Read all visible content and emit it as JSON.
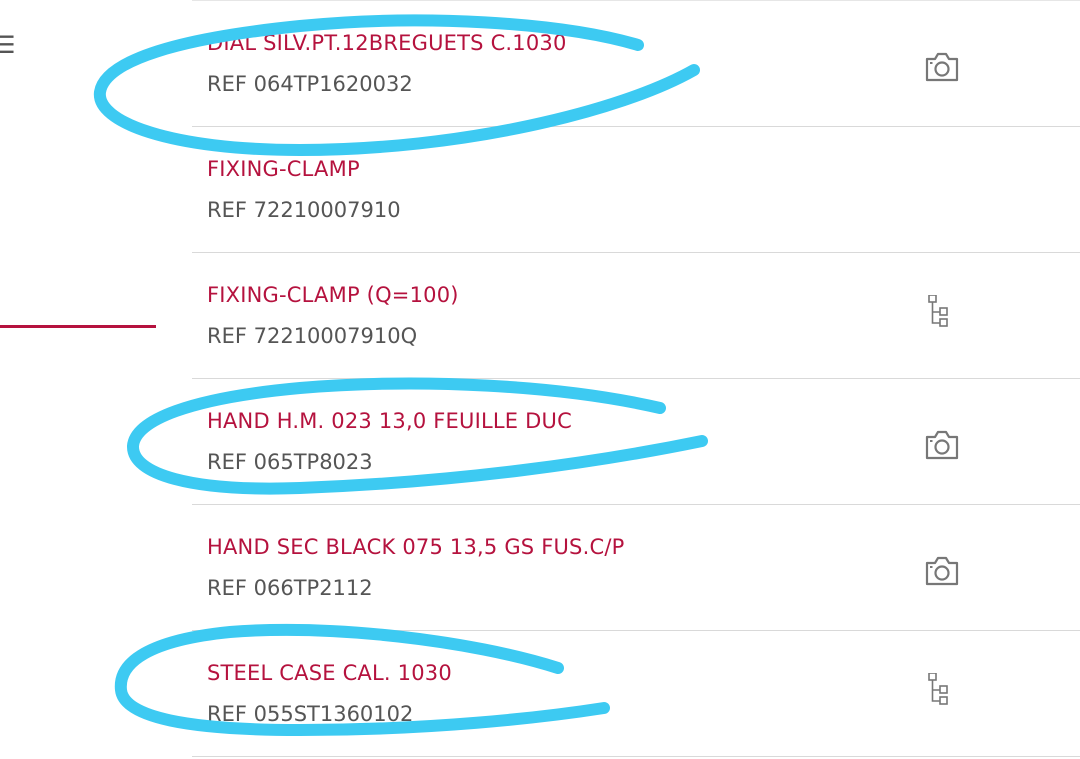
{
  "colors": {
    "accent": "#b5123e",
    "ref_text": "#555555",
    "divider": "#d9d9d9",
    "icon": "#777777",
    "annotation": "#3dcaf2"
  },
  "sidebar": {
    "menu_glyph": "☰",
    "active_indicator": true
  },
  "parts": [
    {
      "name": "DIAL SILV.PT.12BREGUETS C.1030",
      "ref": "REF 064TP1620032",
      "icon": "camera-icon"
    },
    {
      "name": "FIXING-CLAMP",
      "ref": "REF 72210007910",
      "icon": ""
    },
    {
      "name": "FIXING-CLAMP (Q=100)",
      "ref": "REF 72210007910Q",
      "icon": "tree-structure-icon"
    },
    {
      "name": "HAND H.M. 023 13,0 FEUILLE DUC",
      "ref": "REF 065TP8023",
      "icon": "camera-icon"
    },
    {
      "name": "HAND SEC BLACK 075 13,5 GS FUS.C/P",
      "ref": "REF 066TP2112",
      "icon": "camera-icon"
    },
    {
      "name": "STEEL CASE CAL. 1030",
      "ref": "REF 055ST1360102",
      "icon": "tree-structure-icon"
    }
  ],
  "annotations": [
    "circle-around-row-1",
    "circle-around-row-4",
    "circle-around-row-6"
  ]
}
